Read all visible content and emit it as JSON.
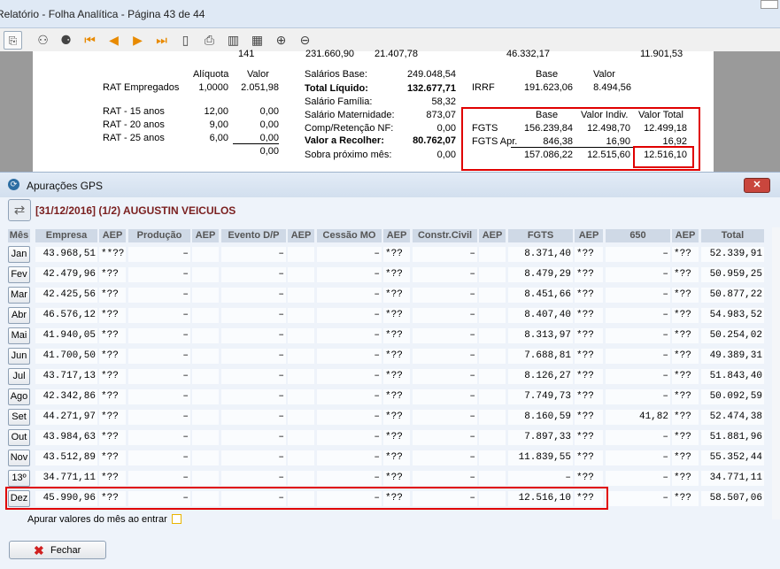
{
  "window": {
    "title": "Relatório - Folha Analítica - Página 43 de 44"
  },
  "toolbar": {
    "icons": [
      "export-icon",
      "binoculars-icon",
      "binoculars-dark-icon",
      "first-page-icon",
      "prev-page-icon",
      "next-page-icon",
      "last-page-icon",
      "page-setup-icon",
      "print-icon",
      "columns-icon",
      "layout-icon",
      "zoom-in-icon",
      "zoom-out-icon"
    ]
  },
  "report": {
    "top_partial": [
      "141",
      "231.660,90",
      "21.407,78",
      "46.332,17",
      "11.901,53"
    ],
    "rat": {
      "h_aliquota": "Alíquota",
      "h_valor": "Valor",
      "rows": [
        {
          "label": "RAT Empregados",
          "aliq": "1,0000",
          "valor": "2.051,98"
        },
        {
          "label": "RAT - 15 anos",
          "aliq": "12,00",
          "valor": "0,00"
        },
        {
          "label": "RAT - 20 anos",
          "aliq": "9,00",
          "valor": "0,00"
        },
        {
          "label": "RAT - 25 anos",
          "aliq": "6,00",
          "valor": "0,00"
        }
      ],
      "total": "0,00"
    },
    "salarios": [
      {
        "label": "Salários Base:",
        "value": "249.048,54",
        "bold": false
      },
      {
        "label": "Total Líquido:",
        "value": "132.677,71",
        "bold": true
      },
      {
        "label": "Salário Família:",
        "value": "58,32",
        "bold": false
      },
      {
        "label": "Salário Maternidade:",
        "value": "873,07",
        "bold": false
      },
      {
        "label": "Comp/Retenção NF:",
        "value": "0,00",
        "bold": false
      },
      {
        "label": "Valor a Recolher:",
        "value": "80.762,07",
        "bold": true
      },
      {
        "label": "Sobra próximo mês:",
        "value": "0,00",
        "bold": false
      }
    ],
    "irrf": {
      "h_base": "Base",
      "h_valor": "Valor",
      "label": "IRRF",
      "base": "191.623,06",
      "valor": "8.494,56"
    },
    "fgts": {
      "h_base": "Base",
      "h_indiv": "Valor Indiv.",
      "h_total": "Valor Total",
      "rows": [
        {
          "label": "FGTS",
          "base": "156.239,84",
          "indiv": "12.498,70",
          "total": "12.499,18"
        },
        {
          "label": "FGTS Apr.",
          "base": "846,38",
          "indiv": "16,90",
          "total": "16,92"
        }
      ],
      "sum_base": "157.086,22",
      "sum_indiv": "12.515,60",
      "sum_total": "12.516,10"
    }
  },
  "dialog": {
    "title": "Apurações GPS",
    "header": "[31/12/2016] (1/2) AUGUSTIN VEICULOS",
    "columns": [
      "Mês",
      "Empresa",
      "AEP",
      "Produção",
      "AEP",
      "Evento D/P",
      "AEP",
      "Cessão MO",
      "AEP",
      "Constr.Civil",
      "AEP",
      "FGTS",
      "AEP",
      "650",
      "AEP",
      "Total"
    ],
    "rows": [
      {
        "mes": "Jan",
        "empresa": "43.968,51",
        "aep1": "**??",
        "prod": "–",
        "aep2": "",
        "evento": "–",
        "aep3": "",
        "cessao": "–",
        "aep4": "*??",
        "constr": "–",
        "aep5": "",
        "fgts": "8.371,40",
        "aep6": "*??",
        "v650": "–",
        "aep7": "*??",
        "total": "52.339,91"
      },
      {
        "mes": "Fev",
        "empresa": "42.479,96",
        "aep1": "*??",
        "prod": "–",
        "aep2": "",
        "evento": "–",
        "aep3": "",
        "cessao": "–",
        "aep4": "*??",
        "constr": "–",
        "aep5": "",
        "fgts": "8.479,29",
        "aep6": "*??",
        "v650": "–",
        "aep7": "*??",
        "total": "50.959,25"
      },
      {
        "mes": "Mar",
        "empresa": "42.425,56",
        "aep1": "*??",
        "prod": "–",
        "aep2": "",
        "evento": "–",
        "aep3": "",
        "cessao": "–",
        "aep4": "*??",
        "constr": "–",
        "aep5": "",
        "fgts": "8.451,66",
        "aep6": "*??",
        "v650": "–",
        "aep7": "*??",
        "total": "50.877,22"
      },
      {
        "mes": "Abr",
        "empresa": "46.576,12",
        "aep1": "*??",
        "prod": "–",
        "aep2": "",
        "evento": "–",
        "aep3": "",
        "cessao": "–",
        "aep4": "*??",
        "constr": "–",
        "aep5": "",
        "fgts": "8.407,40",
        "aep6": "*??",
        "v650": "–",
        "aep7": "*??",
        "total": "54.983,52"
      },
      {
        "mes": "Mai",
        "empresa": "41.940,05",
        "aep1": "*??",
        "prod": "–",
        "aep2": "",
        "evento": "–",
        "aep3": "",
        "cessao": "–",
        "aep4": "*??",
        "constr": "–",
        "aep5": "",
        "fgts": "8.313,97",
        "aep6": "*??",
        "v650": "–",
        "aep7": "*??",
        "total": "50.254,02"
      },
      {
        "mes": "Jun",
        "empresa": "41.700,50",
        "aep1": "*??",
        "prod": "–",
        "aep2": "",
        "evento": "–",
        "aep3": "",
        "cessao": "–",
        "aep4": "*??",
        "constr": "–",
        "aep5": "",
        "fgts": "7.688,81",
        "aep6": "*??",
        "v650": "–",
        "aep7": "*??",
        "total": "49.389,31"
      },
      {
        "mes": "Jul",
        "empresa": "43.717,13",
        "aep1": "*??",
        "prod": "–",
        "aep2": "",
        "evento": "–",
        "aep3": "",
        "cessao": "–",
        "aep4": "*??",
        "constr": "–",
        "aep5": "",
        "fgts": "8.126,27",
        "aep6": "*??",
        "v650": "–",
        "aep7": "*??",
        "total": "51.843,40"
      },
      {
        "mes": "Ago",
        "empresa": "42.342,86",
        "aep1": "*??",
        "prod": "–",
        "aep2": "",
        "evento": "–",
        "aep3": "",
        "cessao": "–",
        "aep4": "*??",
        "constr": "–",
        "aep5": "",
        "fgts": "7.749,73",
        "aep6": "*??",
        "v650": "–",
        "aep7": "*??",
        "total": "50.092,59"
      },
      {
        "mes": "Set",
        "empresa": "44.271,97",
        "aep1": "*??",
        "prod": "–",
        "aep2": "",
        "evento": "–",
        "aep3": "",
        "cessao": "–",
        "aep4": "*??",
        "constr": "–",
        "aep5": "",
        "fgts": "8.160,59",
        "aep6": "*??",
        "v650": "41,82",
        "aep7": "*??",
        "total": "52.474,38"
      },
      {
        "mes": "Out",
        "empresa": "43.984,63",
        "aep1": "*??",
        "prod": "–",
        "aep2": "",
        "evento": "–",
        "aep3": "",
        "cessao": "–",
        "aep4": "*??",
        "constr": "–",
        "aep5": "",
        "fgts": "7.897,33",
        "aep6": "*??",
        "v650": "–",
        "aep7": "*??",
        "total": "51.881,96"
      },
      {
        "mes": "Nov",
        "empresa": "43.512,89",
        "aep1": "*??",
        "prod": "–",
        "aep2": "",
        "evento": "–",
        "aep3": "",
        "cessao": "–",
        "aep4": "*??",
        "constr": "–",
        "aep5": "",
        "fgts": "11.839,55",
        "aep6": "*??",
        "v650": "–",
        "aep7": "*??",
        "total": "55.352,44"
      },
      {
        "mes": "13º",
        "empresa": "34.771,11",
        "aep1": "*??",
        "prod": "–",
        "aep2": "",
        "evento": "–",
        "aep3": "",
        "cessao": "–",
        "aep4": "*??",
        "constr": "–",
        "aep5": "",
        "fgts": "–",
        "aep6": "*??",
        "v650": "–",
        "aep7": "*??",
        "total": "34.771,11"
      },
      {
        "mes": "Dez",
        "empresa": "45.990,96",
        "aep1": "*??",
        "prod": "–",
        "aep2": "",
        "evento": "–",
        "aep3": "",
        "cessao": "–",
        "aep4": "*??",
        "constr": "–",
        "aep5": "",
        "fgts": "12.516,10",
        "aep6": "*??",
        "v650": "–",
        "aep7": "*??",
        "total": "58.507,06"
      }
    ],
    "checkbox_label": "Apurar valores do mês ao entrar",
    "close_label": "Fechar"
  },
  "colors": {
    "highlight": "#e00000",
    "header_text": "#7a1f1f"
  }
}
